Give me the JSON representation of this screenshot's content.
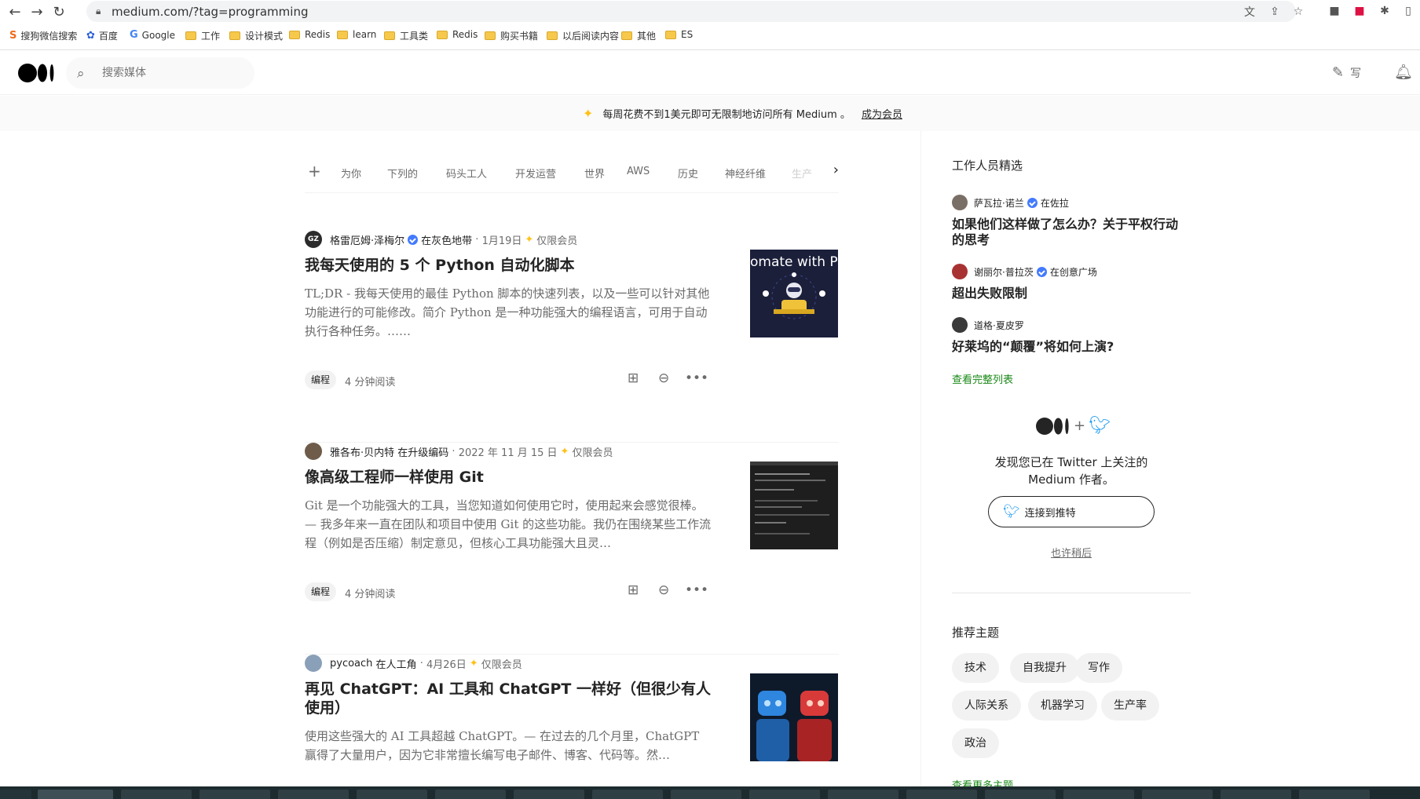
{
  "browser": {
    "url": "medium.com/?tag=programming",
    "bookmarks": [
      {
        "label": "搜狗微信搜索",
        "type": "sogou"
      },
      {
        "label": "百度",
        "type": "baidu"
      },
      {
        "label": "Google",
        "type": "google"
      },
      {
        "label": "工作",
        "type": "folder"
      },
      {
        "label": "设计模式",
        "type": "folder"
      },
      {
        "label": "Redis",
        "type": "folder"
      },
      {
        "label": "learn",
        "type": "folder"
      },
      {
        "label": "工具类",
        "type": "folder"
      },
      {
        "label": "Redis",
        "type": "folder"
      },
      {
        "label": "购买书籍",
        "type": "folder"
      },
      {
        "label": "以后阅读内容",
        "type": "folder"
      },
      {
        "label": "其他",
        "type": "folder"
      },
      {
        "label": "ES",
        "type": "folder"
      }
    ]
  },
  "header": {
    "search_placeholder": "搜索媒体",
    "write_label": "写"
  },
  "banner": {
    "text": "每周花费不到1美元即可无限制地访问所有 Medium 。",
    "link": "成为会员"
  },
  "tabs": [
    "为你",
    "下列的",
    "码头工人",
    "开发运营",
    "世界",
    "AWS",
    "历史",
    "神经纤维",
    "生产"
  ],
  "articles": [
    {
      "avatar_text": "GZ",
      "author": "格雷厄姆·泽梅尔",
      "publication": "在灰色地带",
      "date": "1月19日",
      "members": "仅限会员",
      "title": "我每天使用的 5 个 Python 自动化脚本",
      "subtitle": "TL;DR - 我每天使用的最佳 Python 脚本的快速列表，以及一些可以针对其他功能进行的可能修改。简介 Python 是一种功能强大的编程语言，可用于自动执行各种任务。……",
      "tag": "编程",
      "read_time": "4 分钟阅读",
      "thumb_text": "omate with Py"
    },
    {
      "author": "雅各布·贝内特",
      "publication": "在升级编码",
      "date": "2022 年 11 月 15 日",
      "members": "仅限会员",
      "title": "像高级工程师一样使用 Git",
      "subtitle": "Git 是一个功能强大的工具，当您知道如何使用它时，使用起来会感觉很棒。— 我多年来一直在团队和项目中使用 Git 的这些功能。我仍在围绕某些工作流程（例如是否压缩）制定意见，但核心工具功能强大且灵…",
      "tag": "编程",
      "read_time": "4 分钟阅读"
    },
    {
      "author": "pycoach",
      "publication": "在人工角",
      "date": "4月26日",
      "members": "仅限会员",
      "title": "再见 ChatGPT：AI 工具和 ChatGPT 一样好（但很少有人使用）",
      "subtitle": "使用这些强大的 AI 工具超越 ChatGPT。— 在过去的几个月里，ChatGPT 赢得了大量用户，因为它非常擅长编写电子邮件、博客、代码等。然…"
    }
  ],
  "sidebar": {
    "staff_picks_heading": "工作人员精选",
    "picks": [
      {
        "author": "萨瓦拉·诺兰",
        "verified": true,
        "publication": "在佐拉",
        "title": "如果他们这样做了怎么办？关于平权行动的思考"
      },
      {
        "author": "谢丽尔·普拉茨",
        "verified": true,
        "publication": "在创意广场",
        "title": "超出失败限制"
      },
      {
        "author": "道格·夏皮罗",
        "verified": false,
        "publication": "",
        "title": "好莱坞的“颠覆”将如何上演?"
      }
    ],
    "full_list_link": "查看完整列表",
    "twitter_text": "发现您已在 Twitter 上关注的 Medium 作者。",
    "twitter_button": "连接到推特",
    "maybe_later": "也许稍后",
    "topics_heading": "推荐主题",
    "topics": [
      "技术",
      "自我提升",
      "写作",
      "人际关系",
      "机器学习",
      "生产率",
      "政治"
    ],
    "more_topics": "查看更多主题"
  },
  "colors": {
    "accent_green": "#1a8917",
    "member_star": "#ffc017",
    "verified_blue": "#437aff",
    "twitter_blue": "#1d9bf0"
  }
}
